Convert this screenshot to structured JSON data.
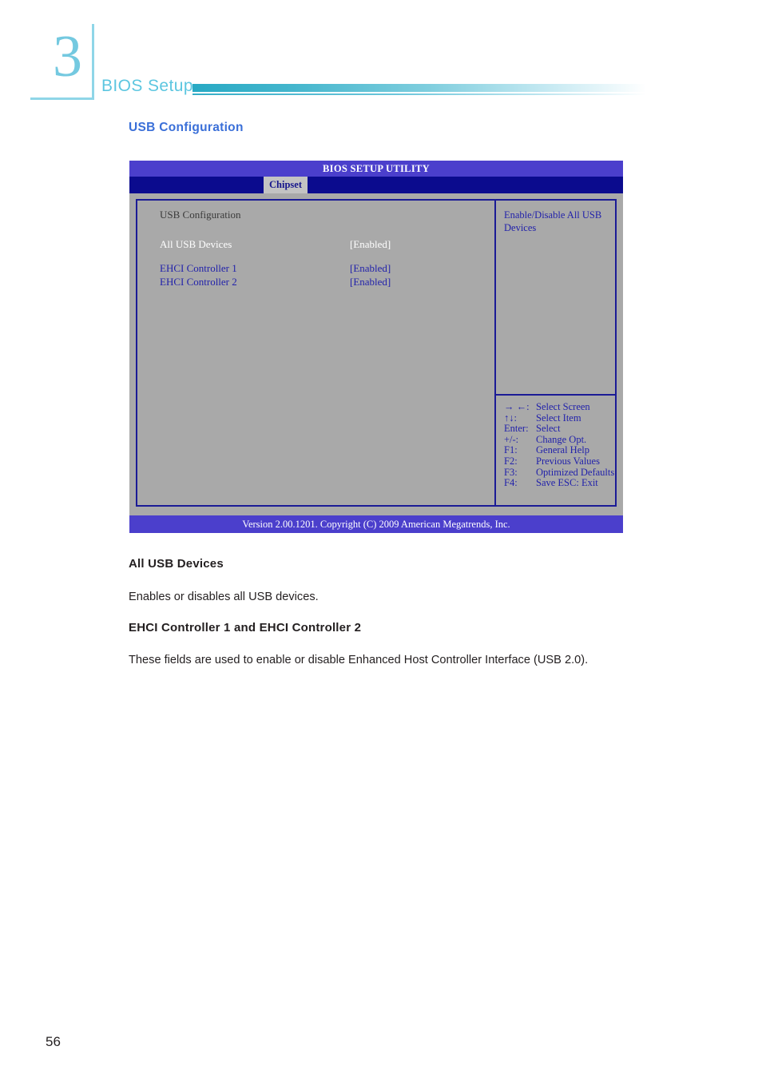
{
  "chapter": {
    "number": "3",
    "running_title": "BIOS Setup"
  },
  "section_heading": "USB Configuration",
  "bios": {
    "title": "BIOS SETUP UTILITY",
    "tab": "Chipset",
    "section_title": "USB Configuration",
    "rows": [
      {
        "label": "All USB Devices",
        "value": "[Enabled]",
        "selected": true
      },
      {
        "label": "EHCI Controller 1",
        "value": "[Enabled]",
        "selected": false
      },
      {
        "label": "EHCI Controller 2",
        "value": "[Enabled]",
        "selected": false
      }
    ],
    "help_text": "Enable/Disable All USB Devices",
    "nav_keys": [
      {
        "key": "→ ←:",
        "action": "Select Screen"
      },
      {
        "key": "↑↓:",
        "action": "Select Item"
      },
      {
        "key": "Enter:",
        "action": "Select"
      },
      {
        "key": "+/-:",
        "action": "Change Opt."
      },
      {
        "key": "F1:",
        "action": "General Help"
      },
      {
        "key": "F2:",
        "action": "Previous Values"
      },
      {
        "key": "F3:",
        "action": "Optimized Defaults"
      },
      {
        "key": "F4:",
        "action": "Save   ESC: Exit"
      }
    ],
    "footer": "Version 2.00.1201. Copyright (C) 2009 American Megatrends, Inc."
  },
  "body": {
    "h3_all_usb": "All USB Devices",
    "p_all_usb": "Enables or disables all USB devices.",
    "h3_ehci": "EHCI Controller 1 and EHCI Controller 2",
    "p_ehci": "These fields are used to enable or disable Enhanced Host Controller Interface (USB 2.0)."
  },
  "page_number": "56",
  "colors": {
    "accent_cyan": "#5cc6e0",
    "heading_blue": "#3a6fd8",
    "bios_titlebar": "#4b3fcc",
    "bios_tabbar": "#0b0b8e",
    "bios_bg": "#a9a9a9",
    "bios_text_blue": "#2222aa"
  }
}
